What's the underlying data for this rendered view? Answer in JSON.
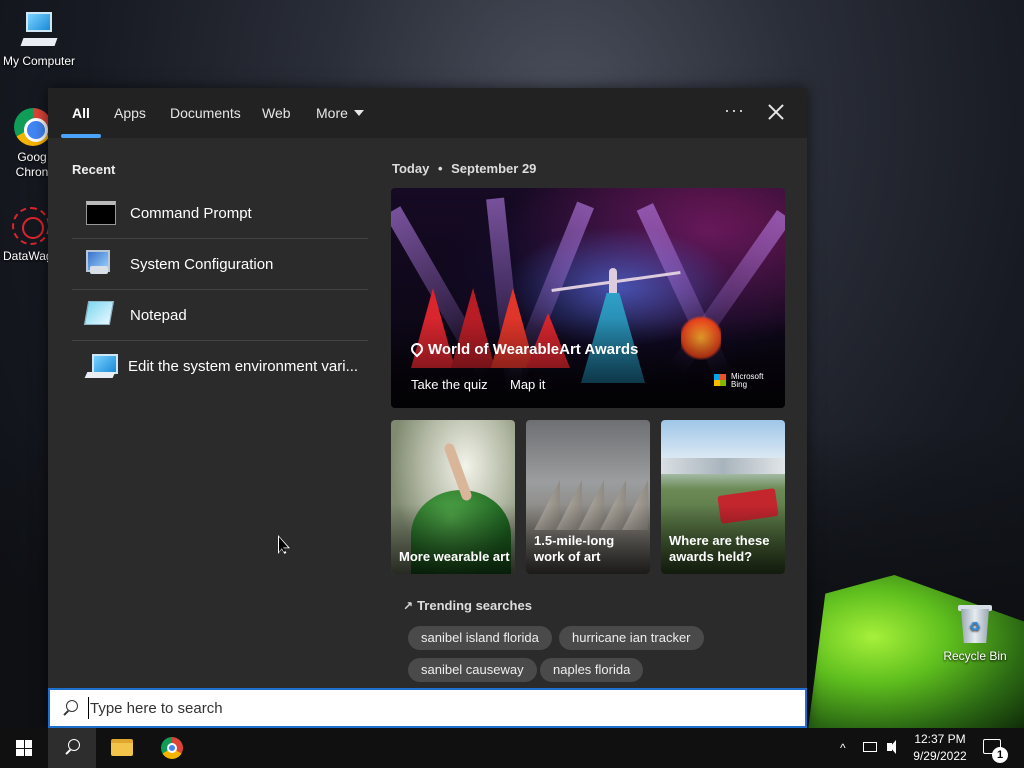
{
  "desktop": {
    "icons": [
      {
        "label": "My Computer"
      },
      {
        "label": "Goog Chron"
      },
      {
        "label": "DataWag"
      },
      {
        "label": "Recycle Bin"
      }
    ]
  },
  "flyout": {
    "tabs": [
      {
        "label": "All"
      },
      {
        "label": "Apps"
      },
      {
        "label": "Documents"
      },
      {
        "label": "Web"
      },
      {
        "label": "More"
      }
    ],
    "menu_icon": "more-dots-icon",
    "close_icon": "close-icon",
    "recent": {
      "title": "Recent",
      "items": [
        {
          "label": "Command Prompt",
          "icon": "command-prompt-icon"
        },
        {
          "label": "System Configuration",
          "icon": "system-configuration-icon"
        },
        {
          "label": "Notepad",
          "icon": "notepad-icon"
        },
        {
          "label": "Edit the system environment vari...",
          "icon": "environment-variables-icon"
        }
      ]
    },
    "today": {
      "label": "Today",
      "separator": "•",
      "date": "September 29"
    },
    "hero": {
      "title": "World of WearableArt Awards",
      "link_quiz": "Take the quiz",
      "link_map": "Map it",
      "brand_line1": "Microsoft",
      "brand_line2": "Bing"
    },
    "tiles": [
      {
        "label": "More wearable art"
      },
      {
        "label": "1.5-mile-long work of art"
      },
      {
        "label": "Where are these awards held?"
      }
    ],
    "trending": {
      "title": "Trending searches",
      "chips": [
        {
          "label": "sanibel island florida"
        },
        {
          "label": "hurricane ian tracker"
        },
        {
          "label": "sanibel causeway"
        },
        {
          "label": "naples florida"
        }
      ]
    }
  },
  "search": {
    "placeholder": "Type here to search",
    "value": ""
  },
  "taskbar": {
    "apps": [
      {
        "name": "start",
        "icon": "windows-logo-icon"
      },
      {
        "name": "search",
        "icon": "search-icon",
        "active": true
      },
      {
        "name": "file-explorer",
        "icon": "folder-icon"
      },
      {
        "name": "chrome",
        "icon": "chrome-icon"
      }
    ],
    "tray": {
      "chevron": "^",
      "time": "12:37 PM",
      "date": "9/29/2022",
      "notification_count": "1"
    }
  },
  "colors": {
    "accent": "#4aa3ff",
    "search_border": "#1f6fd0",
    "flyout_bg": "#2b2b2b",
    "chip_bg": "#4a4a4a",
    "taskbar_bg": "#101010"
  }
}
